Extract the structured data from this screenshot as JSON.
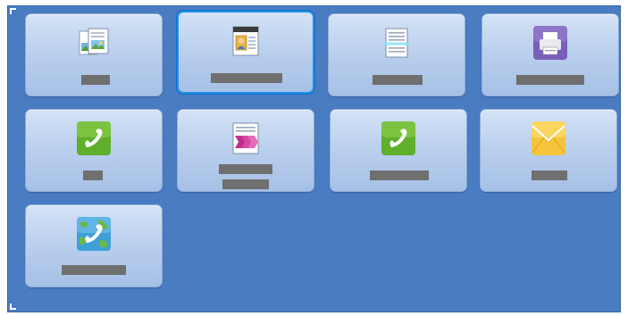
{
  "screen": {
    "title": "",
    "colors": {
      "panel": "#4a7cc2",
      "tile": "#c4d7f1",
      "selected_border": "#1f8fe8",
      "redaction": "#6f6f6f"
    }
  },
  "tiles": [
    {
      "id": "tile-1",
      "icon": "copy-icon",
      "label": "",
      "selected": false
    },
    {
      "id": "tile-2",
      "icon": "id-card-copy-icon",
      "label": "",
      "selected": true
    },
    {
      "id": "tile-3",
      "icon": "scan-document-icon",
      "label": "",
      "selected": false
    },
    {
      "id": "tile-4",
      "icon": "printer-icon",
      "label": "",
      "selected": false
    },
    {
      "id": "tile-5",
      "icon": "fax-phone-icon",
      "label": "",
      "selected": false
    },
    {
      "id": "tile-6",
      "icon": "workflow-scanning-icon",
      "label": "",
      "selected": false
    },
    {
      "id": "tile-7",
      "icon": "server-fax-phone-icon",
      "label": "",
      "selected": false
    },
    {
      "id": "tile-8",
      "icon": "email-envelope-icon",
      "label": "",
      "selected": false
    },
    {
      "id": "tile-9",
      "icon": "internet-fax-icon",
      "label": "",
      "selected": false
    }
  ]
}
